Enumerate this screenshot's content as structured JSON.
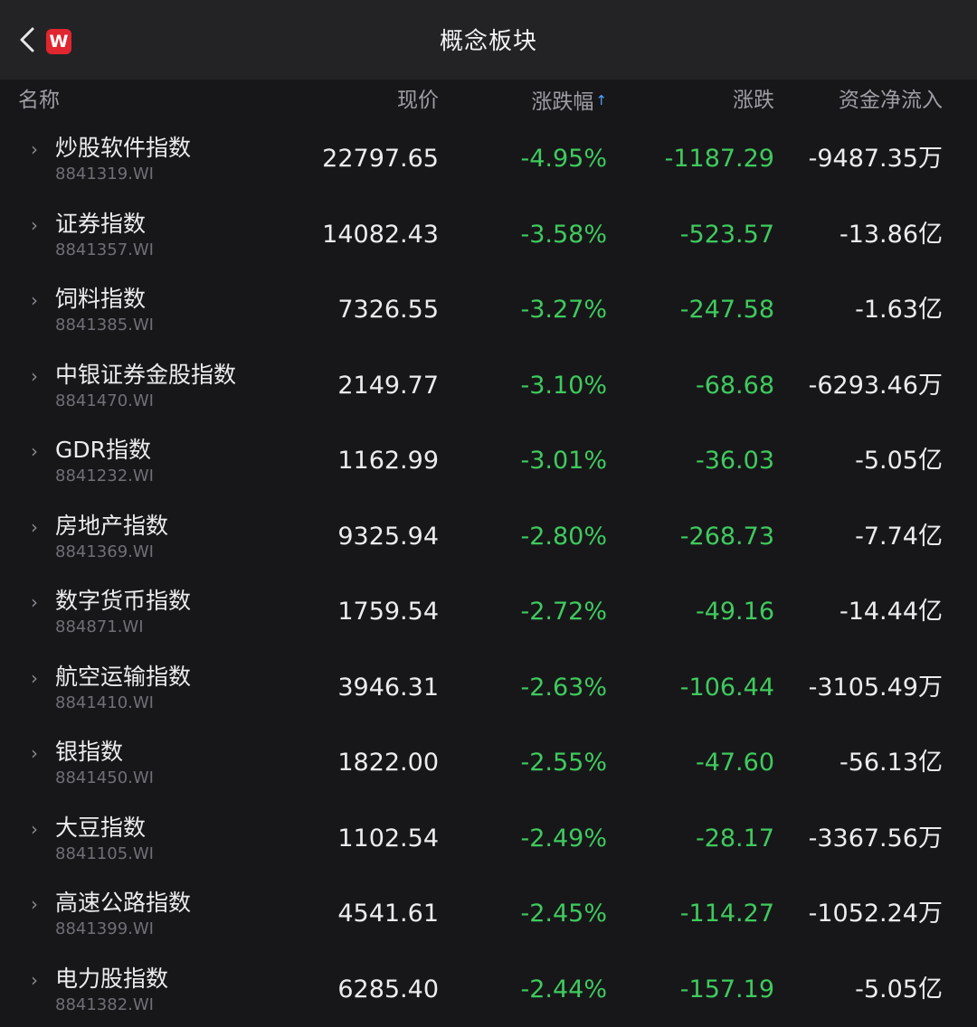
{
  "header": {
    "title": "概念板块",
    "logo_text": "W",
    "back_icon": "chevron-left-icon"
  },
  "columns": {
    "name": "名称",
    "price": "现价",
    "pct": "涨跌幅",
    "pct_sort_arrow": "↑",
    "change": "涨跌",
    "flow": "资金净流入"
  },
  "colors": {
    "background": "#17171a",
    "header_bg": "#232326",
    "down_green": "#3fca5d",
    "sort_blue": "#4da3ff",
    "logo_red": "#e0262f"
  },
  "rows": [
    {
      "name": "炒股软件指数",
      "code": "8841319.WI",
      "price": "22797.65",
      "pct": "-4.95%",
      "change": "-1187.29",
      "flow": "-9487.35万"
    },
    {
      "name": "证券指数",
      "code": "8841357.WI",
      "price": "14082.43",
      "pct": "-3.58%",
      "change": "-523.57",
      "flow": "-13.86亿"
    },
    {
      "name": "饲料指数",
      "code": "8841385.WI",
      "price": "7326.55",
      "pct": "-3.27%",
      "change": "-247.58",
      "flow": "-1.63亿"
    },
    {
      "name": "中银证券金股指数",
      "code": "8841470.WI",
      "price": "2149.77",
      "pct": "-3.10%",
      "change": "-68.68",
      "flow": "-6293.46万"
    },
    {
      "name": "GDR指数",
      "code": "8841232.WI",
      "price": "1162.99",
      "pct": "-3.01%",
      "change": "-36.03",
      "flow": "-5.05亿"
    },
    {
      "name": "房地产指数",
      "code": "8841369.WI",
      "price": "9325.94",
      "pct": "-2.80%",
      "change": "-268.73",
      "flow": "-7.74亿"
    },
    {
      "name": "数字货币指数",
      "code": "884871.WI",
      "price": "1759.54",
      "pct": "-2.72%",
      "change": "-49.16",
      "flow": "-14.44亿"
    },
    {
      "name": "航空运输指数",
      "code": "8841410.WI",
      "price": "3946.31",
      "pct": "-2.63%",
      "change": "-106.44",
      "flow": "-3105.49万"
    },
    {
      "name": "银指数",
      "code": "8841450.WI",
      "price": "1822.00",
      "pct": "-2.55%",
      "change": "-47.60",
      "flow": "-56.13亿"
    },
    {
      "name": "大豆指数",
      "code": "8841105.WI",
      "price": "1102.54",
      "pct": "-2.49%",
      "change": "-28.17",
      "flow": "-3367.56万"
    },
    {
      "name": "高速公路指数",
      "code": "8841399.WI",
      "price": "4541.61",
      "pct": "-2.45%",
      "change": "-114.27",
      "flow": "-1052.24万"
    },
    {
      "name": "电力股指数",
      "code": "8841382.WI",
      "price": "6285.40",
      "pct": "-2.44%",
      "change": "-157.19",
      "flow": "-5.05亿"
    }
  ]
}
